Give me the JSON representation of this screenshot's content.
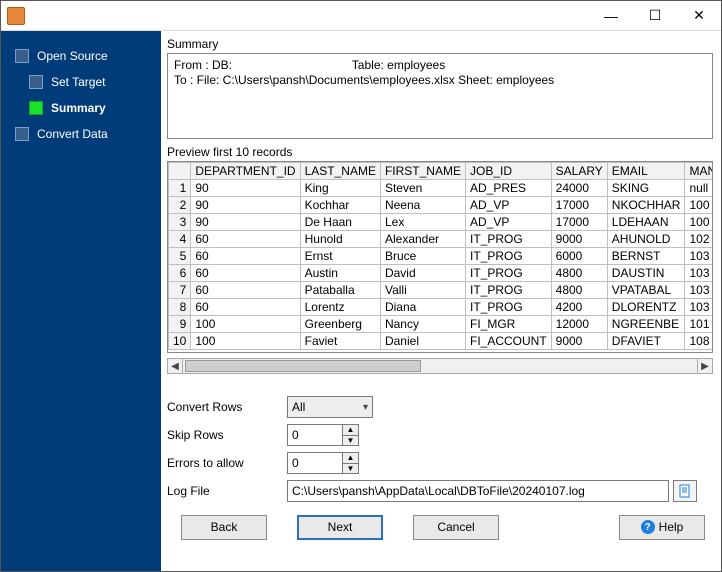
{
  "window": {
    "minimize": "—",
    "maximize": "☐",
    "close": "✕"
  },
  "sidebar": {
    "items": [
      {
        "label": "Open Source"
      },
      {
        "label": "Set Target"
      },
      {
        "label": "Summary"
      },
      {
        "label": "Convert Data"
      }
    ]
  },
  "summary": {
    "heading": "Summary",
    "line1": "From : DB:                                    Table: employees",
    "line2": "To : File: C:\\Users\\pansh\\Documents\\employees.xlsx Sheet: employees"
  },
  "preview": {
    "heading": "Preview first 10 records",
    "columns": [
      "DEPARTMENT_ID",
      "LAST_NAME",
      "FIRST_NAME",
      "JOB_ID",
      "SALARY",
      "EMAIL",
      "MANAG"
    ],
    "rows": [
      [
        "90",
        "King",
        "Steven",
        "AD_PRES",
        "24000",
        "SKING",
        "null"
      ],
      [
        "90",
        "Kochhar",
        "Neena",
        "AD_VP",
        "17000",
        "NKOCHHAR",
        "100"
      ],
      [
        "90",
        "De Haan",
        "Lex",
        "AD_VP",
        "17000",
        "LDEHAAN",
        "100"
      ],
      [
        "60",
        "Hunold",
        "Alexander",
        "IT_PROG",
        "9000",
        "AHUNOLD",
        "102"
      ],
      [
        "60",
        "Ernst",
        "Bruce",
        "IT_PROG",
        "6000",
        "BERNST",
        "103"
      ],
      [
        "60",
        "Austin",
        "David",
        "IT_PROG",
        "4800",
        "DAUSTIN",
        "103"
      ],
      [
        "60",
        "Pataballa",
        "Valli",
        "IT_PROG",
        "4800",
        "VPATABAL",
        "103"
      ],
      [
        "60",
        "Lorentz",
        "Diana",
        "IT_PROG",
        "4200",
        "DLORENTZ",
        "103"
      ],
      [
        "100",
        "Greenberg",
        "Nancy",
        "FI_MGR",
        "12000",
        "NGREENBE",
        "101"
      ],
      [
        "100",
        "Faviet",
        "Daniel",
        "FI_ACCOUNT",
        "9000",
        "DFAVIET",
        "108"
      ]
    ]
  },
  "form": {
    "convert_rows_label": "Convert Rows",
    "convert_rows_value": "All",
    "skip_rows_label": "Skip Rows",
    "skip_rows_value": "0",
    "errors_label": "Errors to allow",
    "errors_value": "0",
    "logfile_label": "Log File",
    "logfile_value": "C:\\Users\\pansh\\AppData\\Local\\DBToFile\\20240107.log"
  },
  "footer": {
    "back": "Back",
    "next": "Next",
    "cancel": "Cancel",
    "help": "Help"
  }
}
